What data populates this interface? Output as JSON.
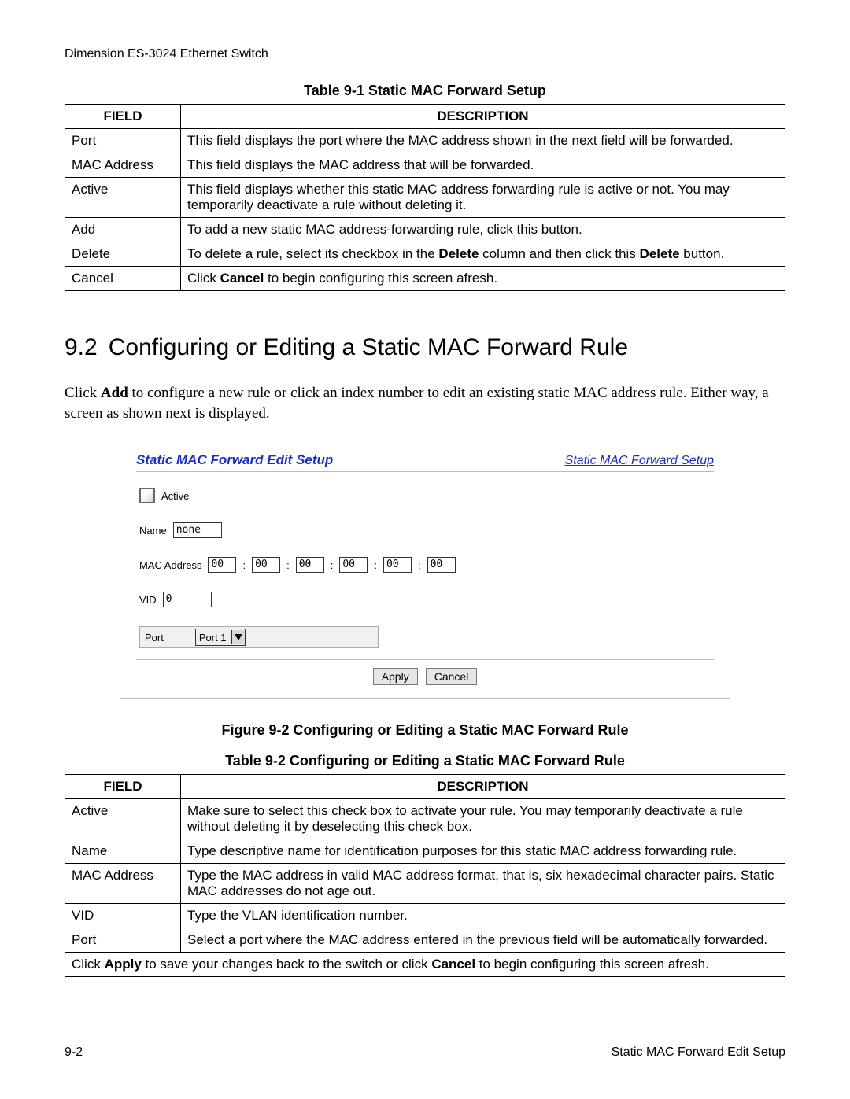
{
  "header": {
    "title": "Dimension ES-3024 Ethernet Switch"
  },
  "table1": {
    "caption": "Table 9-1 Static MAC Forward Setup",
    "head": {
      "field": "FIELD",
      "desc": "DESCRIPTION"
    },
    "rows": [
      {
        "field": "Port",
        "desc": "This field displays the port where the MAC address shown in the next field will be forwarded."
      },
      {
        "field": "MAC Address",
        "desc": "This field displays the MAC address that will be forwarded."
      },
      {
        "field": "Active",
        "desc": "This field displays whether this static MAC address forwarding rule is active or not. You may temporarily deactivate a rule without deleting it."
      },
      {
        "field": "Add",
        "desc": "To add a new static MAC address-forwarding rule, click this button."
      },
      {
        "field": "Delete",
        "desc_pre": "To delete a rule, select its checkbox in the ",
        "desc_b1": "Delete",
        "desc_mid": " column and then click this ",
        "desc_b2": "Delete",
        "desc_post": " button."
      },
      {
        "field": "Cancel",
        "desc_pre": "Click ",
        "desc_b1": "Cancel",
        "desc_post": " to begin configuring this screen afresh."
      }
    ]
  },
  "section": {
    "number": "9.2",
    "title": "Configuring or Editing a Static MAC Forward Rule",
    "para_pre": "Click ",
    "para_b": "Add",
    "para_post": " to configure a new rule or click an index number to edit an existing static MAC address rule. Either way, a screen as shown next is displayed."
  },
  "form": {
    "title": "Static MAC Forward Edit Setup",
    "link": "Static MAC Forward Setup",
    "active_label": "Active",
    "name_label": "Name",
    "name_value": "none",
    "mac_label": "MAC Address",
    "mac": [
      "00",
      "00",
      "00",
      "00",
      "00",
      "00"
    ],
    "vid_label": "VID",
    "vid_value": "0",
    "port_label": "Port",
    "port_value": "Port 1",
    "apply": "Apply",
    "cancel": "Cancel"
  },
  "figure_caption": "Figure 9-2 Configuring or Editing a Static MAC Forward Rule",
  "table2": {
    "caption": "Table 9-2 Configuring or Editing a Static MAC Forward Rule",
    "head": {
      "field": "FIELD",
      "desc": "DESCRIPTION"
    },
    "rows": [
      {
        "field": "Active",
        "desc": "Make sure to select this check box to activate your rule. You may temporarily deactivate a rule without deleting it by deselecting this check box."
      },
      {
        "field": "Name",
        "desc": "Type descriptive name for identification purposes for this static MAC address forwarding rule."
      },
      {
        "field": "MAC Address",
        "desc": "Type the MAC address in valid MAC address format, that is, six hexadecimal character pairs. Static MAC addresses do not age out."
      },
      {
        "field": "VID",
        "desc": "Type the VLAN identification number."
      },
      {
        "field": "Port",
        "desc": "Select a port where the MAC address entered in the previous field will be automatically forwarded."
      }
    ],
    "foot_pre": "Click ",
    "foot_b1": "Apply",
    "foot_mid": " to save your changes back to the switch or click ",
    "foot_b2": "Cancel",
    "foot_post": " to begin configuring this screen afresh."
  },
  "footer": {
    "left": "9-2",
    "right": "Static MAC Forward Edit Setup"
  }
}
